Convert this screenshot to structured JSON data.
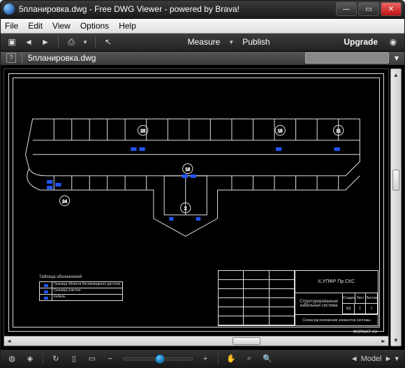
{
  "window": {
    "title": "5планировка.dwg - Free DWG Viewer - powered by Brava!"
  },
  "menubar": {
    "file": "File",
    "edit": "Edit",
    "view": "View",
    "options": "Options",
    "help": "Help"
  },
  "toolbar": {
    "measure": "Measure",
    "publish": "Publish",
    "upgrade": "Upgrade"
  },
  "tabbar": {
    "filename": "5планировка.dwg"
  },
  "statusbar": {
    "model": "Model"
  },
  "titleblock": {
    "project": "К.УПФР Пр.СКС",
    "line1": "Структурированная кабельная система",
    "line2": "Схема расположения элементов системы",
    "cols": {
      "a": "Стадия",
      "b": "Лист",
      "c": "Листов",
      "va": "КД",
      "vb": "1",
      "vc": "1"
    },
    "format": "ФОРМАТ   А3"
  },
  "legend": {
    "header": "Таблица обозначений",
    "rows": [
      "Граница области беспроводного доступа",
      "Граница участка",
      "Кабель"
    ]
  },
  "drawing": {
    "markers": [
      "23",
      "15",
      "11",
      "18",
      "2",
      "24"
    ]
  }
}
